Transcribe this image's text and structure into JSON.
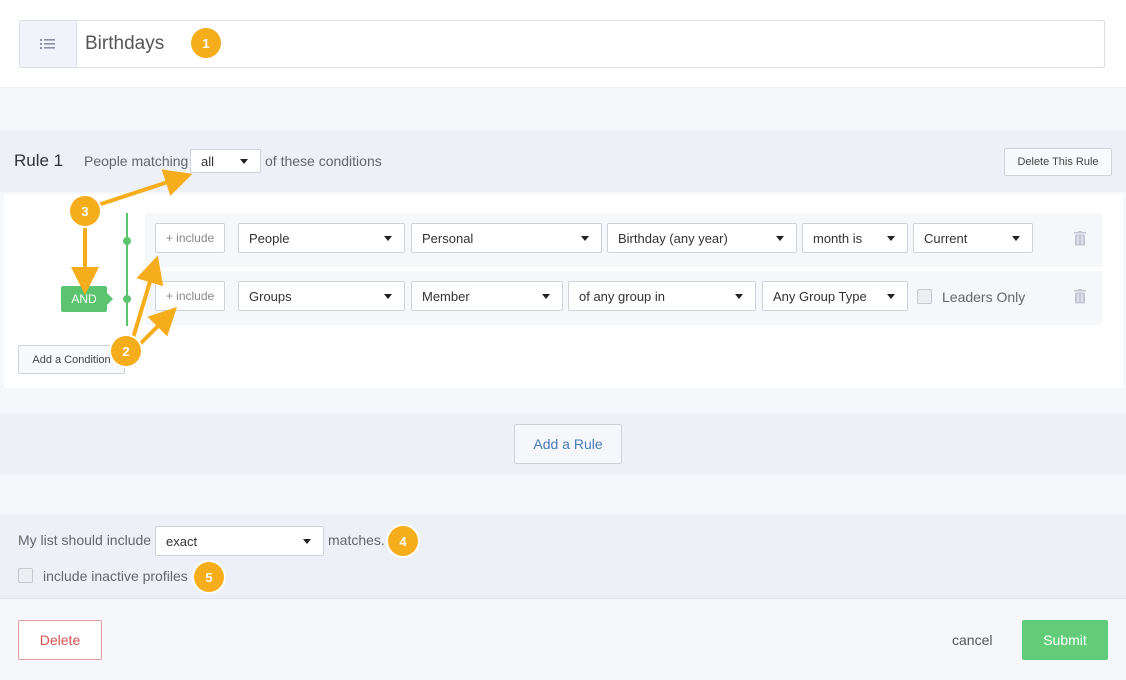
{
  "list": {
    "title": "Birthdays",
    "icon": "list-icon"
  },
  "rule": {
    "title": "Rule 1",
    "prefix": "People matching",
    "match_mode": "all",
    "suffix": "of these conditions",
    "delete_label": "Delete This Rule",
    "connector": "AND",
    "add_condition_label": "Add a Condition",
    "conditions": [
      {
        "include_label": "+ include",
        "selects": [
          "People",
          "Personal",
          "Birthday (any year)",
          "month is",
          "Current"
        ]
      },
      {
        "include_label": "+ include",
        "selects": [
          "Groups",
          "Member",
          "of any group in",
          "Any Group Type"
        ],
        "checkbox_label": "Leaders Only"
      }
    ]
  },
  "add_rule_label": "Add a Rule",
  "settings": {
    "include_prefix": "My list should include",
    "match_type": "exact",
    "include_suffix": "matches.",
    "inactive_label": "include inactive profiles"
  },
  "footer": {
    "delete_label": "Delete",
    "cancel_label": "cancel",
    "submit_label": "Submit"
  },
  "annotations": [
    "1",
    "2",
    "3",
    "4",
    "5"
  ],
  "colors": {
    "accent_orange": "#f6ad1b",
    "green": "#5cc46e",
    "submit_green": "#63cc79",
    "danger": "#d9534f",
    "link_blue": "#4a7ab8"
  }
}
